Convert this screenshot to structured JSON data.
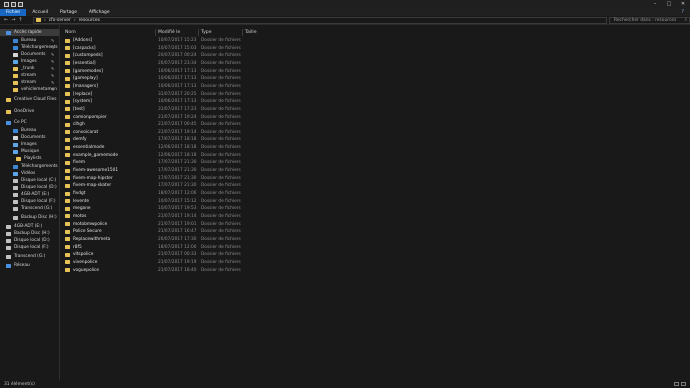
{
  "ribbon": {
    "tabs": [
      "Fichier",
      "Accueil",
      "Partage",
      "Affichage"
    ],
    "help": "?"
  },
  "address": {
    "back": "←",
    "forward": "→",
    "up": "↑",
    "path": [
      "cfx-server",
      "resources"
    ],
    "search_placeholder": "Rechercher dans : resources"
  },
  "window": {
    "minimize": "–",
    "maximize": "□",
    "close": "✕"
  },
  "columns": [
    "Nom",
    "Modifié le",
    "Type",
    "Taille"
  ],
  "files": [
    {
      "name": "[Addons]",
      "date": "10/07/2017 15:23",
      "type": "Dossier de fichiers"
    },
    {
      "name": "[carpacks]",
      "date": "10/07/2017 15:03",
      "type": "Dossier de fichiers"
    },
    {
      "name": "[custompeds]",
      "date": "20/07/2017 00:24",
      "type": "Dossier de fichiers"
    },
    {
      "name": "[essential]",
      "date": "20/07/2017 23:34",
      "type": "Dossier de fichiers"
    },
    {
      "name": "[gamemodes]",
      "date": "10/06/2017 17:13",
      "type": "Dossier de fichiers"
    },
    {
      "name": "[gameplay]",
      "date": "10/06/2017 17:13",
      "type": "Dossier de fichiers"
    },
    {
      "name": "[managers]",
      "date": "10/06/2017 17:13",
      "type": "Dossier de fichiers"
    },
    {
      "name": "[replace]",
      "date": "31/07/2017 20:25",
      "type": "Dossier de fichiers"
    },
    {
      "name": "[system]",
      "date": "10/06/2017 17:13",
      "type": "Dossier de fichiers"
    },
    {
      "name": "[test]",
      "date": "31/07/2017 17:23",
      "type": "Dossier de fichiers"
    },
    {
      "name": "camionpompier",
      "date": "21/07/2017 19:24",
      "type": "Dossier de fichiers"
    },
    {
      "name": "clhgh",
      "date": "21/07/2017 00:45",
      "type": "Dossier de fichiers"
    },
    {
      "name": "convoicarat",
      "date": "21/07/2017 19:14",
      "type": "Dossier de fichiers"
    },
    {
      "name": "demfy",
      "date": "17/07/2017 18:18",
      "type": "Dossier de fichiers"
    },
    {
      "name": "essentialmode",
      "date": "12/06/2017 18:18",
      "type": "Dossier de fichiers"
    },
    {
      "name": "example_gamemode",
      "date": "12/06/2017 18:18",
      "type": "Dossier de fichiers"
    },
    {
      "name": "fivem",
      "date": "17/07/2017 21:30",
      "type": "Dossier de fichiers"
    },
    {
      "name": "fivem-awesome1501",
      "date": "17/07/2017 21:30",
      "type": "Dossier de fichiers"
    },
    {
      "name": "fivem-map-hipster",
      "date": "17/07/2017 21:30",
      "type": "Dossier de fichiers"
    },
    {
      "name": "fivem-map-skater",
      "date": "17/07/2017 21:30",
      "type": "Dossier de fichiers"
    },
    {
      "name": "fivdgt",
      "date": "18/07/2017 12:06",
      "type": "Dossier de fichiers"
    },
    {
      "name": "levente",
      "date": "10/07/2017 15:12",
      "type": "Dossier de fichiers"
    },
    {
      "name": "megane",
      "date": "10/07/2017 19:53",
      "type": "Dossier de fichiers"
    },
    {
      "name": "motos",
      "date": "21/07/2017 19:14",
      "type": "Dossier de fichiers"
    },
    {
      "name": "motobmwpolice",
      "date": "21/07/2017 19:01",
      "type": "Dossier de fichiers"
    },
    {
      "name": "Police Secure",
      "date": "21/07/2017 16:47",
      "type": "Dossier de fichiers"
    },
    {
      "name": "Replacewithmeta",
      "date": "20/07/2017 17:30",
      "type": "Dossier de fichiers"
    },
    {
      "name": "r8f5",
      "date": "18/07/2017 12:00",
      "type": "Dossier de fichiers"
    },
    {
      "name": "vltspolice",
      "date": "21/07/2017 00:33",
      "type": "Dossier de fichiers"
    },
    {
      "name": "vivenpolice",
      "date": "21/07/2017 19:19",
      "type": "Dossier de fichiers"
    },
    {
      "name": "voguepolice",
      "date": "21/07/2017 18:40",
      "type": "Dossier de fichiers"
    }
  ],
  "sidebar": [
    {
      "label": "Accès rapide",
      "icon": "star-icon",
      "color": "#4a90e2",
      "pin": false
    },
    {
      "label": "Bureau",
      "icon": "desktop-icon",
      "color": "#3c86d8",
      "pin": true
    },
    {
      "label": "Téléchargements",
      "icon": "download-icon",
      "color": "#3c86d8",
      "pin": true
    },
    {
      "label": "Documents",
      "icon": "documents-icon",
      "color": "#d6d6d6",
      "pin": true
    },
    {
      "label": "Images",
      "icon": "images-icon",
      "color": "#5fa6e6",
      "pin": true
    },
    {
      "label": "_trunk",
      "icon": "folder-icon",
      "color": "#e6c155",
      "pin": true
    },
    {
      "label": "stream",
      "icon": "folder-icon",
      "color": "#e6c155",
      "pin": true
    },
    {
      "label": "stream",
      "icon": "folder-icon",
      "color": "#e6c155",
      "pin": true
    },
    {
      "label": "vehiclemetamen",
      "icon": "folder-icon",
      "color": "#e6c155",
      "pin": true
    },
    {
      "label": "Creative Cloud Files",
      "icon": "creative-cloud-icon",
      "color": "#e6c155",
      "pin": false
    },
    {
      "label": "OneDrive",
      "icon": "onedrive-icon",
      "color": "#e6c155",
      "pin": false
    },
    {
      "label": "Ce PC",
      "icon": "computer-icon",
      "color": "#4a90e2",
      "pin": false
    },
    {
      "label": "Bureau",
      "icon": "desktop-icon",
      "color": "#3c86d8",
      "pin": false
    },
    {
      "label": "Documents",
      "icon": "documents-icon",
      "color": "#d6d6d6",
      "pin": false
    },
    {
      "label": "Images",
      "icon": "images-icon",
      "color": "#5fa6e6",
      "pin": false
    },
    {
      "label": "Musique",
      "icon": "music-icon",
      "color": "#5fa6e6",
      "pin": false
    },
    {
      "label": "Playlists",
      "icon": "playlist-icon",
      "color": "#e6c155",
      "pin": false
    },
    {
      "label": "Téléchargements",
      "icon": "download-icon",
      "color": "#3c86d8",
      "pin": false
    },
    {
      "label": "Vidéos",
      "icon": "video-icon",
      "color": "#5fa6e6",
      "pin": false
    },
    {
      "label": "Disque local (C:)",
      "icon": "drive-icon",
      "color": "#c0c0c0",
      "pin": false
    },
    {
      "label": "Disque local (D:)",
      "icon": "drive-icon",
      "color": "#c0c0c0",
      "pin": false
    },
    {
      "label": "4GB-ADT (E:)",
      "icon": "drive-icon",
      "color": "#c0c0c0",
      "pin": false
    },
    {
      "label": "Disque local (F:)",
      "icon": "drive-icon",
      "color": "#c0c0c0",
      "pin": false
    },
    {
      "label": "Transcend (G:)",
      "icon": "drive-icon",
      "color": "#c0c0c0",
      "pin": false
    },
    {
      "label": "Backup Disc (H:)",
      "icon": "drive-icon",
      "color": "#c0c0c0",
      "pin": false
    },
    {
      "label": "4GB-ADT (E:)",
      "icon": "usb-drive-icon",
      "color": "#c0c0c0",
      "pin": false
    },
    {
      "label": "Backup Disc (H:)",
      "icon": "usb-drive-icon",
      "color": "#c0c0c0",
      "pin": false
    },
    {
      "label": "Disque local (D:)",
      "icon": "usb-drive-icon",
      "color": "#c0c0c0",
      "pin": false
    },
    {
      "label": "Disque local (F:)",
      "icon": "usb-drive-icon",
      "color": "#c0c0c0",
      "pin": false
    },
    {
      "label": "Transcend (G:)",
      "icon": "usb-drive-icon",
      "color": "#c0c0c0",
      "pin": false
    },
    {
      "label": "Réseau",
      "icon": "network-icon",
      "color": "#4a90e2",
      "pin": false
    }
  ],
  "status": {
    "count": "31 élément(s)"
  }
}
